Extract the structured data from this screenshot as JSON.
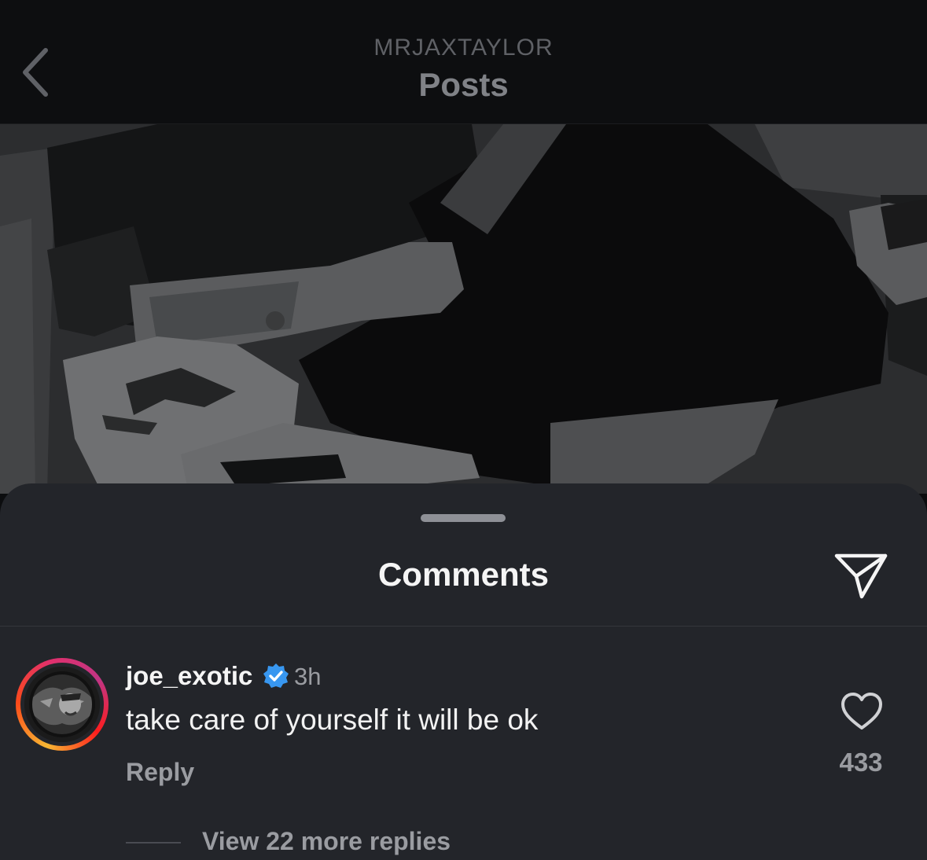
{
  "header": {
    "username": "MRJAXTAYLOR",
    "title": "Posts",
    "back_icon": "chevron-left-icon"
  },
  "post": {
    "image_icon": "post-photo"
  },
  "comments_sheet": {
    "title": "Comments",
    "share_icon": "paper-plane-icon",
    "comment": {
      "username": "joe_exotic",
      "verified_icon": "verified-badge-icon",
      "time": "3h",
      "text": "take care of yourself it will be ok",
      "reply_label": "Reply",
      "like_icon": "heart-outline-icon",
      "like_count": "433",
      "view_replies_label": "View 22 more replies"
    }
  },
  "colors": {
    "sheet_bg": "#23252a",
    "header_bg": "#0d0e10",
    "verified_blue": "#3897f0",
    "ring_gradient": [
      "#f7b733",
      "#fc4a1a",
      "#e1306c",
      "#c13584"
    ]
  }
}
